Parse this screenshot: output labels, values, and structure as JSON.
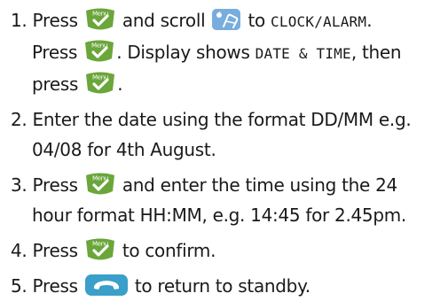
{
  "steps": [
    {
      "number": "1.",
      "t1": "Press",
      "t2": "and scroll",
      "t3": "to",
      "target": "CLOCK/ALARM",
      "t4": ".",
      "t5": "Press",
      "t6": ". Display shows",
      "display": "DATE & TIME",
      "t7": ", then",
      "t8": "press",
      "t9": "."
    },
    {
      "number": "2.",
      "line1": "Enter the date using the format DD/MM e.g.",
      "line2": "04/08 for 4th August."
    },
    {
      "number": "3.",
      "t1": "Press",
      "t2": "and enter the time using the 24",
      "line2": "hour format HH:MM, e.g. 14:45 for 2.45pm."
    },
    {
      "number": "4.",
      "t1": "Press",
      "t2": "to confirm."
    },
    {
      "number": "5.",
      "t1": "Press",
      "t2": "to return to standby."
    }
  ],
  "menu_key": {
    "label": "Menu",
    "icon": "menu-key-icon",
    "color": "#6aa63a",
    "text_color": "#ffffff"
  },
  "scroll_key": {
    "icon": "scroll-key-icon",
    "color": "#5b9bd5"
  },
  "end_key": {
    "icon": "end-call-key-icon",
    "color": "#3a9fc9"
  }
}
